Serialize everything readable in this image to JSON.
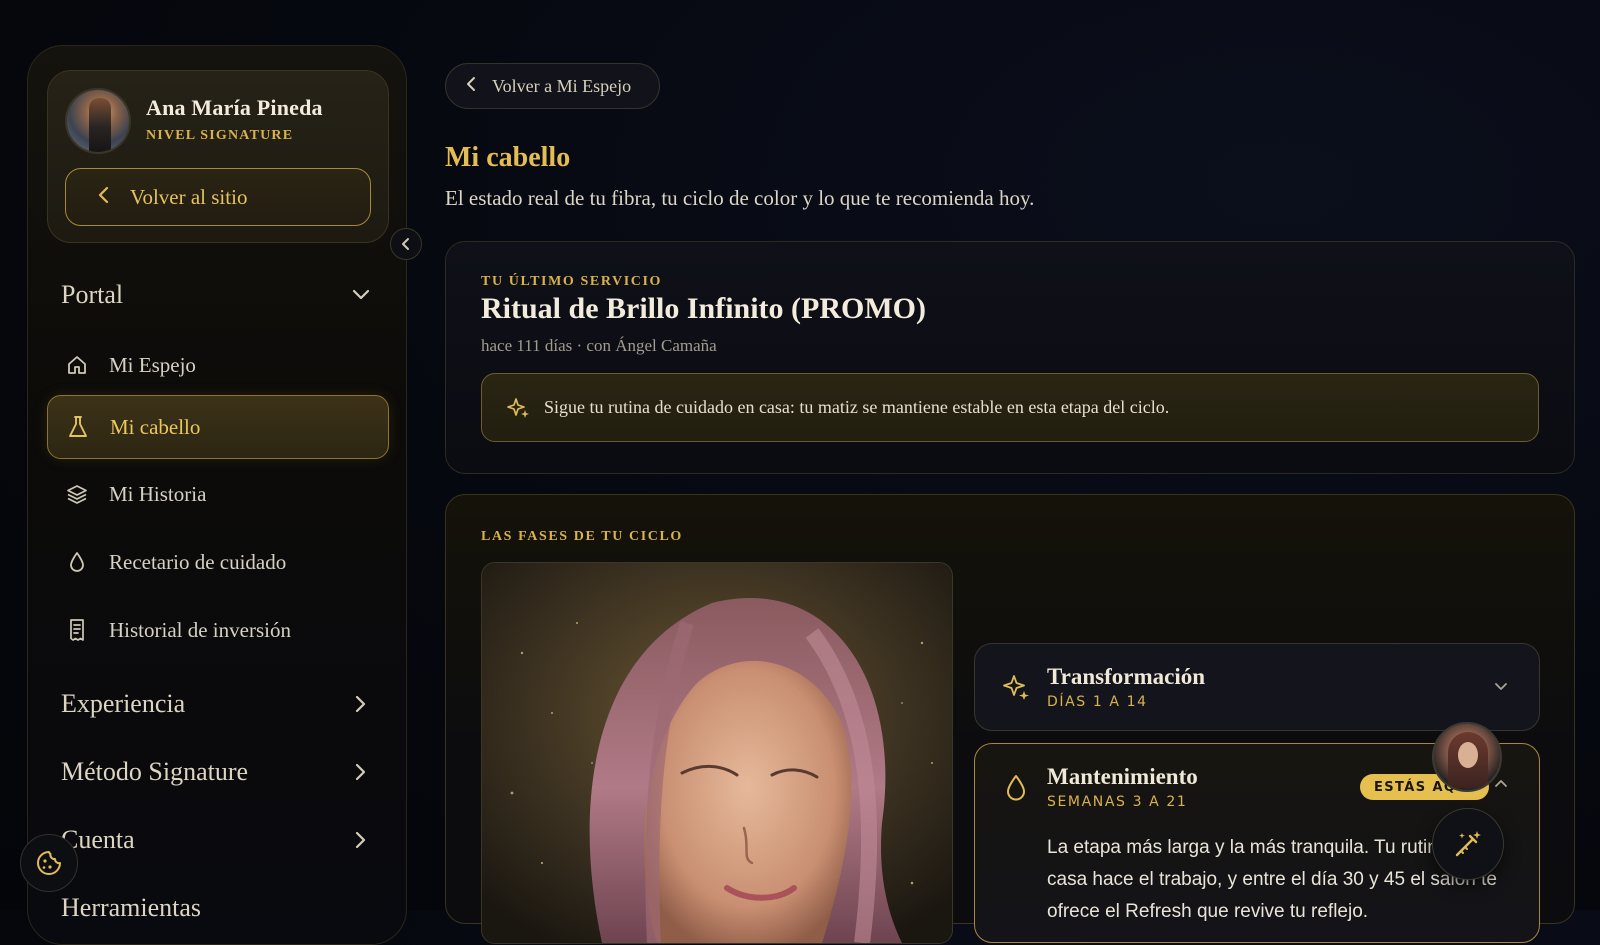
{
  "sidebar": {
    "profile": {
      "name": "Ana María Pineda",
      "level": "NIVEL SIGNATURE",
      "back_label": "Volver al sitio"
    },
    "sections": [
      {
        "label": "Portal",
        "state": "expanded"
      },
      {
        "label": "Experiencia",
        "state": "collapsed"
      },
      {
        "label": "Método Signature",
        "state": "collapsed"
      },
      {
        "label": "Cuenta",
        "state": "collapsed"
      },
      {
        "label": "Herramientas",
        "state": "collapsed"
      }
    ],
    "items": [
      {
        "label": "Mi Espejo",
        "icon": "home-icon"
      },
      {
        "label": "Mi cabello",
        "icon": "flask-icon",
        "active": true
      },
      {
        "label": "Mi Historia",
        "icon": "layers-icon"
      },
      {
        "label": "Recetario de cuidado",
        "icon": "drop-icon"
      },
      {
        "label": "Historial de inversión",
        "icon": "receipt-icon"
      }
    ]
  },
  "main": {
    "back_pill": "Volver a Mi Espejo",
    "title": "Mi cabello",
    "subtitle": "El estado real de tu fibra, tu ciclo de color y lo que te recomienda hoy.",
    "last_service": {
      "eyebrow": "TU ÚLTIMO SERVICIO",
      "name": "Ritual de Brillo Infinito (PROMO)",
      "meta": "hace 111 días · con Ángel Camaña",
      "tip": "Sigue tu rutina de cuidado en casa: tu matiz se mantiene estable en esta etapa del ciclo."
    },
    "cycle": {
      "eyebrow": "LAS FASES DE TU CICLO",
      "phases": [
        {
          "name": "Transformación",
          "range": "DÍAS 1 A 14",
          "icon": "sparkle-icon",
          "expanded": false
        },
        {
          "name": "Mantenimiento",
          "range": "SEMANAS 3 A 21",
          "icon": "drop-icon",
          "expanded": true,
          "badge": "ESTÁS AQUÍ",
          "text": "La etapa más larga y la más tranquila. Tu rutina en casa hace el trabajo, y entre el día 30 y 45 el salón te ofrece el Refresh que revive tu reflejo."
        }
      ]
    }
  },
  "colors": {
    "accent": "#e4bd52",
    "background": "#06080f",
    "text": "#e8e2d3"
  }
}
